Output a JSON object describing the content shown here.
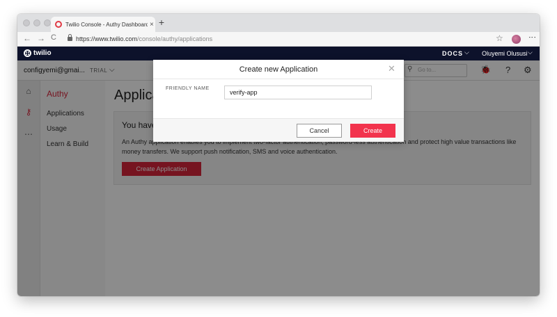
{
  "browser": {
    "tab_title": "Twilio Console - Authy Dashboard",
    "tab_close": "×",
    "new_tab": "+",
    "url_host": "https://www.twilio.com",
    "url_path": "/console/authy/applications",
    "nav_back": "←",
    "nav_forward": "→",
    "nav_reload": "C",
    "bookmark_icon": "☆",
    "menu_icon": "⋮"
  },
  "topbar": {
    "logo_text": "twilio",
    "docs_label": "DOCS",
    "user_name": "Oluyemi Olususi",
    "chevron": "⌵",
    "bg_color": "#0d122b"
  },
  "account": {
    "name": "configyemi@gmai...",
    "plan": "TRIAL",
    "chevron": "⌵",
    "search_placeholder": "Go to...",
    "search_icon": "⚲",
    "debugger_icon": "🐞",
    "help_icon": "?",
    "settings_icon": "⚙"
  },
  "rail": {
    "icons": [
      "home-icon",
      "authy-icon",
      "more-icon"
    ],
    "glyphs": [
      "⌂",
      "⚷",
      "⋯"
    ]
  },
  "leftnav": {
    "title": "Authy",
    "items": [
      "Applications",
      "Usage",
      "Learn & Build"
    ]
  },
  "main": {
    "page_title": "Applications",
    "info_heading": "You have no Authy applications",
    "info_text": "An Authy application enables you to implement two-factor authentication, password-less authentication and protect high value transactions like money transfers. We support push notification, SMS and voice authentication.",
    "create_button": "Create Application"
  },
  "modal": {
    "title": "Create new Application",
    "close": "✕",
    "field_label": "FRIENDLY NAME",
    "field_value": "verify-app",
    "cancel_label": "Cancel",
    "create_label": "Create",
    "accent_color": "#f2334d"
  }
}
